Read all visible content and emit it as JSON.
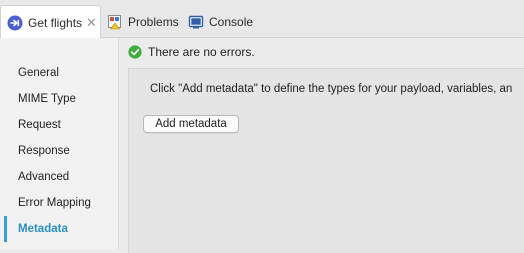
{
  "tabs": [
    {
      "label": "Get flights",
      "icon": "flow-icon"
    },
    {
      "label": "Problems",
      "icon": "problems-icon"
    },
    {
      "label": "Console",
      "icon": "console-icon"
    }
  ],
  "sidebar": {
    "items": [
      {
        "label": "General"
      },
      {
        "label": "MIME Type"
      },
      {
        "label": "Request"
      },
      {
        "label": "Response"
      },
      {
        "label": "Advanced"
      },
      {
        "label": "Error Mapping"
      },
      {
        "label": "Metadata"
      }
    ],
    "selected": "Metadata",
    "accent_color": "#2b8fc6"
  },
  "status": {
    "text": "There are no errors.",
    "icon": "check-circle-icon",
    "color": "#3fae3f"
  },
  "metadata": {
    "hint": "Click \"Add metadata\" to define the types for your payload, variables, an",
    "add_button_label": "Add metadata"
  }
}
